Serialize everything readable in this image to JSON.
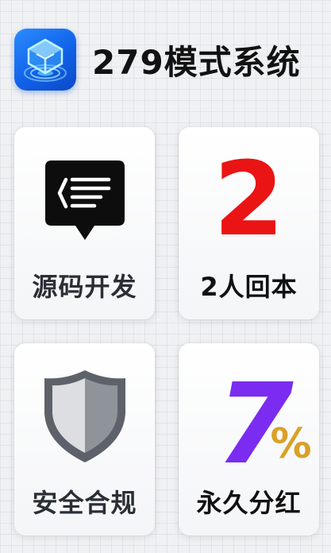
{
  "header": {
    "title": "279模式系统",
    "logo_icon": "cube-hologram-icon"
  },
  "cards": [
    {
      "id": "source-code",
      "label": "源码开发",
      "icon": "code-chat-bubble-icon"
    },
    {
      "id": "two-people",
      "label": "2人回本",
      "highlight": "2",
      "highlight_color": "#ea1414"
    },
    {
      "id": "compliance",
      "label": "安全合规",
      "icon": "shield-icon"
    },
    {
      "id": "dividend",
      "label": "永久分红",
      "highlight": "7",
      "highlight_color": "#7a2cf0",
      "suffix": "%",
      "suffix_color": "#d9a128"
    }
  ]
}
